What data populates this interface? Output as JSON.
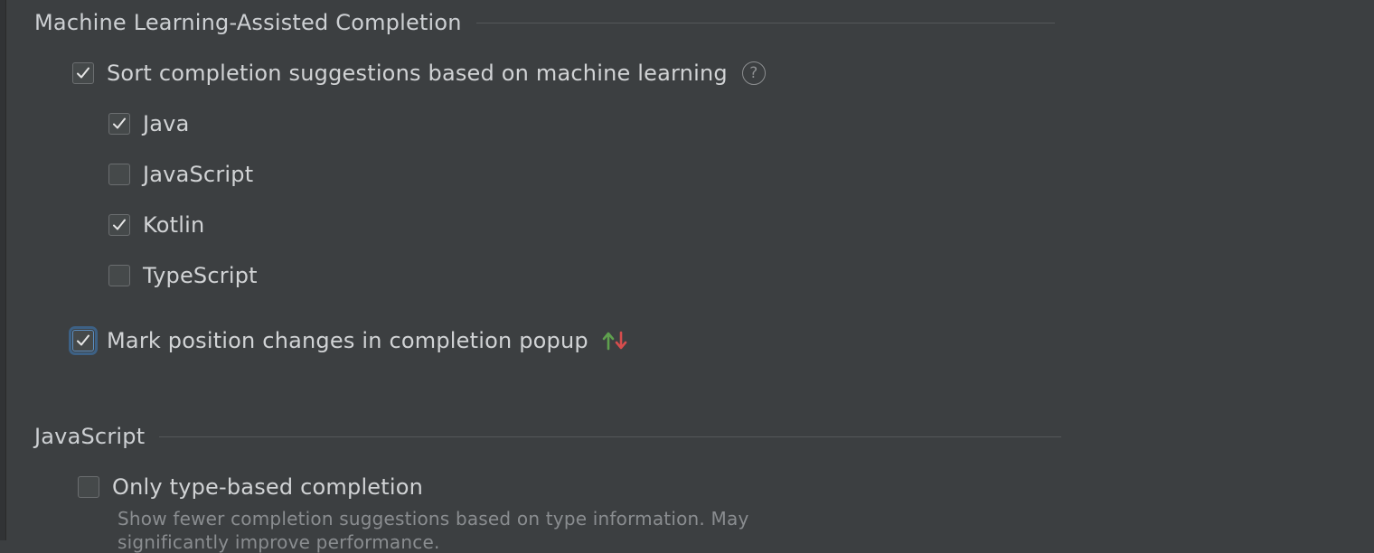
{
  "ml_section": {
    "title": "Machine Learning-Assisted Completion",
    "sort_option": {
      "label": "Sort completion suggestions based on machine learning",
      "checked": true
    },
    "languages": [
      {
        "label": "Java",
        "checked": true
      },
      {
        "label": "JavaScript",
        "checked": false
      },
      {
        "label": "Kotlin",
        "checked": true
      },
      {
        "label": "TypeScript",
        "checked": false
      }
    ],
    "mark_option": {
      "label": "Mark position changes in completion popup",
      "checked": true,
      "focused": true
    },
    "help_glyph": "?",
    "icons": {
      "help": "question-circle-icon",
      "arrows": "up-down-arrows-icon"
    },
    "arrow_colors": {
      "up": "#5fa04e",
      "down": "#d64d4d"
    }
  },
  "js_section": {
    "title": "JavaScript",
    "type_based": {
      "label": "Only type-based completion",
      "checked": false
    },
    "description": "Show fewer completion suggestions based on type information. May",
    "description_cont": "significantly improve performance."
  },
  "colors": {
    "background": "#3c3f41",
    "text": "#cdd0d3",
    "focus": "#3d6185"
  }
}
